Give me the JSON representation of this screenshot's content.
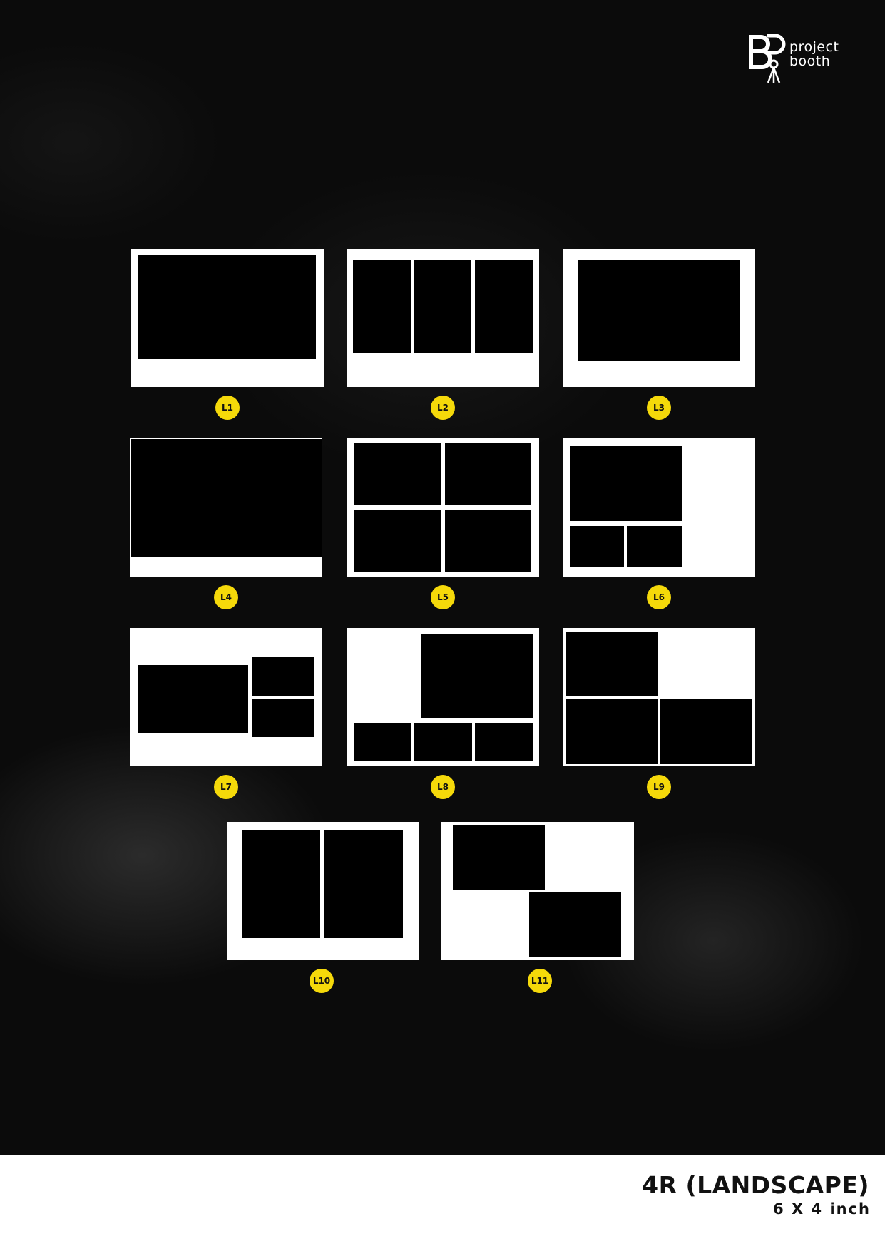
{
  "brand": {
    "logo_icon": "project-booth-tripod-logo",
    "name_line1": "project",
    "name_line2": "booth"
  },
  "layouts": [
    {
      "label": "L1"
    },
    {
      "label": "L2"
    },
    {
      "label": "L3"
    },
    {
      "label": "L4"
    },
    {
      "label": "L5"
    },
    {
      "label": "L6"
    },
    {
      "label": "L7"
    },
    {
      "label": "L8"
    },
    {
      "label": "L9"
    },
    {
      "label": "L10"
    },
    {
      "label": "L11"
    }
  ],
  "footer": {
    "title": "4R (LANDSCAPE)",
    "subtitle": "6 X 4 inch"
  },
  "colors": {
    "background": "#0b0b0b",
    "card": "#ffffff",
    "photo_slot": "#000000",
    "badge": "#f5d90a"
  }
}
